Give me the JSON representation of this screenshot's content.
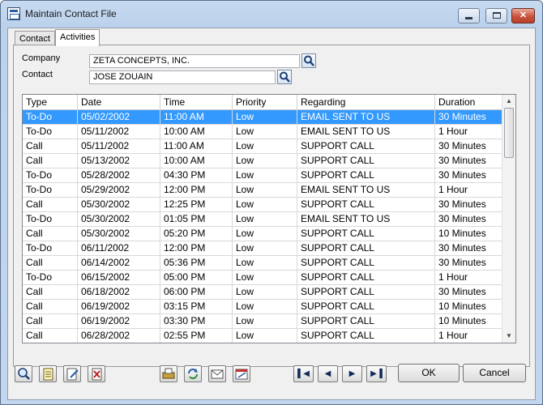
{
  "window": {
    "title": "Maintain Contact File"
  },
  "tabs": [
    {
      "label": "Contact"
    },
    {
      "label": "Activities"
    }
  ],
  "form": {
    "company_label": "Company",
    "company_value": "ZETA CONCEPTS, INC.",
    "contact_label": "Contact",
    "contact_value": "JOSE ZOUAIN"
  },
  "table": {
    "columns": [
      "Type",
      "Date",
      "Time",
      "Priority",
      "Regarding",
      "Duration"
    ],
    "rows": [
      [
        "To-Do",
        "05/02/2002",
        "11:00 AM",
        "Low",
        "EMAIL SENT TO US",
        "30 Minutes"
      ],
      [
        "To-Do",
        "05/11/2002",
        "10:00 AM",
        "Low",
        "EMAIL SENT TO US",
        "1 Hour"
      ],
      [
        "Call",
        "05/11/2002",
        "11:00 AM",
        "Low",
        "SUPPORT CALL",
        "30 Minutes"
      ],
      [
        "Call",
        "05/13/2002",
        "10:00 AM",
        "Low",
        "SUPPORT CALL",
        "30 Minutes"
      ],
      [
        "To-Do",
        "05/28/2002",
        "04:30 PM",
        "Low",
        "SUPPORT CALL",
        "30 Minutes"
      ],
      [
        "To-Do",
        "05/29/2002",
        "12:00 PM",
        "Low",
        "EMAIL SENT TO US",
        "1 Hour"
      ],
      [
        "Call",
        "05/30/2002",
        "12:25 PM",
        "Low",
        "SUPPORT CALL",
        "30 Minutes"
      ],
      [
        "To-Do",
        "05/30/2002",
        "01:05 PM",
        "Low",
        "EMAIL SENT TO US",
        "30 Minutes"
      ],
      [
        "Call",
        "05/30/2002",
        "05:20 PM",
        "Low",
        "SUPPORT CALL",
        "10 Minutes"
      ],
      [
        "To-Do",
        "06/11/2002",
        "12:00 PM",
        "Low",
        "SUPPORT CALL",
        "30 Minutes"
      ],
      [
        "Call",
        "06/14/2002",
        "05:36 PM",
        "Low",
        "SUPPORT CALL",
        "30 Minutes"
      ],
      [
        "To-Do",
        "06/15/2002",
        "05:00 PM",
        "Low",
        "SUPPORT CALL",
        "1 Hour"
      ],
      [
        "Call",
        "06/18/2002",
        "06:00 PM",
        "Low",
        "SUPPORT CALL",
        "30 Minutes"
      ],
      [
        "Call",
        "06/19/2002",
        "03:15 PM",
        "Low",
        "SUPPORT CALL",
        "10 Minutes"
      ],
      [
        "Call",
        "06/19/2002",
        "03:30 PM",
        "Low",
        "SUPPORT CALL",
        "10 Minutes"
      ],
      [
        "Call",
        "06/28/2002",
        "02:55 PM",
        "Low",
        "SUPPORT CALL",
        "1 Hour"
      ]
    ],
    "selected_row": 0
  },
  "buttons": {
    "ok": "OK",
    "cancel": "Cancel"
  },
  "icons": {
    "window_controls": [
      "minimize-icon",
      "maximize-icon",
      "close-icon"
    ],
    "lookup": "magnifier-icon",
    "left_toolbar": [
      "zoom-icon",
      "memo-icon",
      "edit-note-icon",
      "delete-icon"
    ],
    "middle_toolbar": [
      "print-icon",
      "refresh-icon",
      "email-icon",
      "calendar-icon"
    ],
    "navigation": [
      "first-record-icon",
      "previous-record-icon",
      "next-record-icon",
      "last-record-icon"
    ]
  },
  "colors": {
    "selection": "#3399ff",
    "window_frame": "#bcd2ec"
  }
}
